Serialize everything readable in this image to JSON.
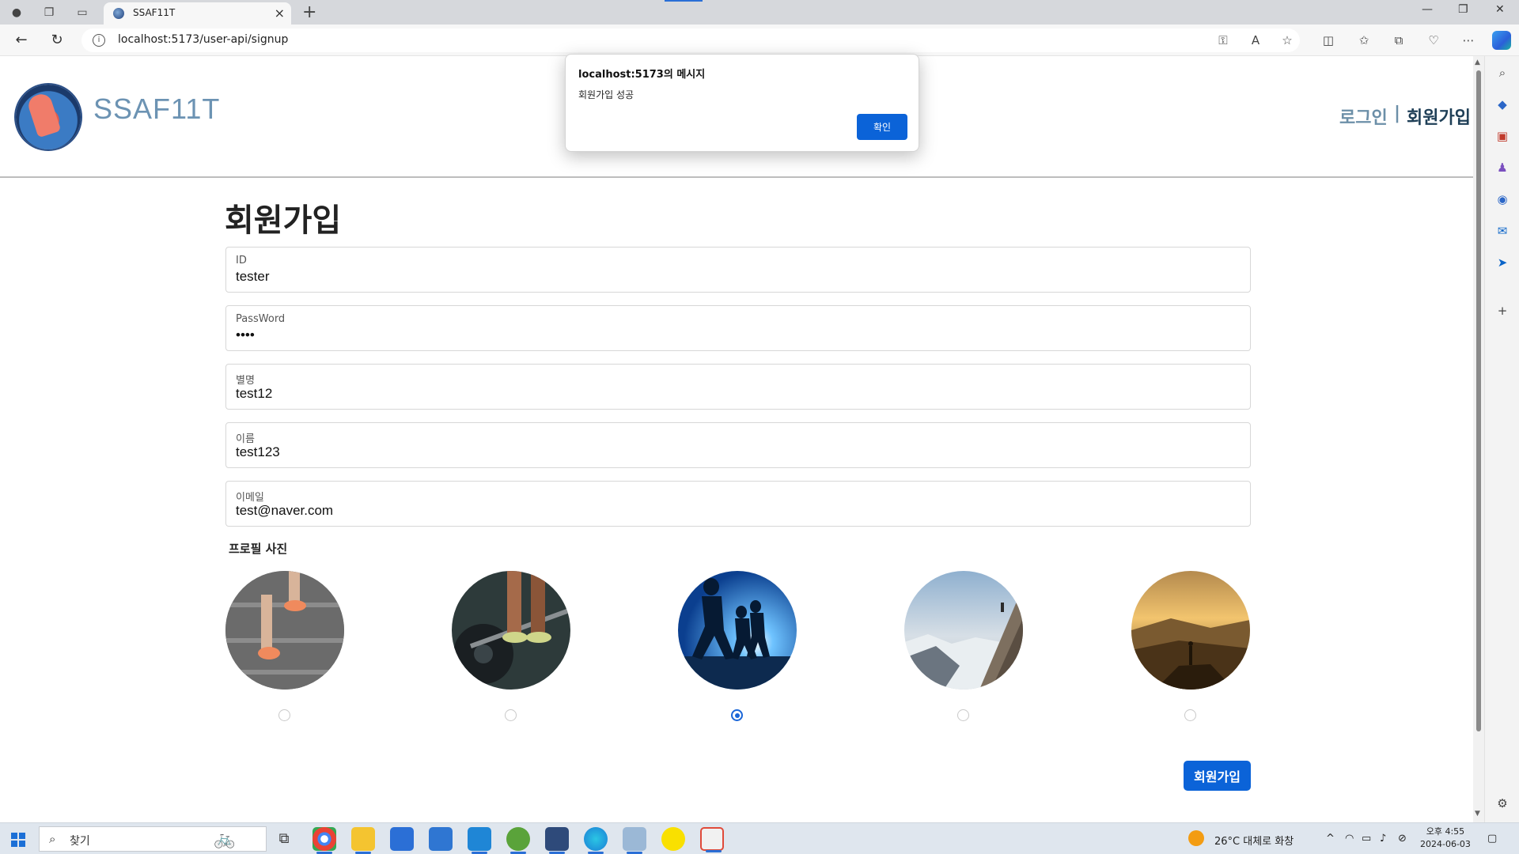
{
  "browser": {
    "tab_title": "SSAF11T",
    "url": "localhost:5173/user-api/signup"
  },
  "site": {
    "brand": "SSAF11T",
    "nav_login": "로그인",
    "nav_separator": "|",
    "nav_signup": "회원가입"
  },
  "form": {
    "title": "회원가입",
    "fields": [
      {
        "label": "ID",
        "value": "tester"
      },
      {
        "label": "PassWord",
        "value": "••••"
      },
      {
        "label": "별명",
        "value": "test12"
      },
      {
        "label": "이름",
        "value": "test123"
      },
      {
        "label": "이메일",
        "value": "test@naver.com"
      }
    ],
    "profile_label": "프로필 사진",
    "profile_images": [
      {
        "icon": "stairs-running-photo",
        "selected": false
      },
      {
        "icon": "barbell-lifting-photo",
        "selected": false
      },
      {
        "icon": "runners-sunrise-photo",
        "selected": true
      },
      {
        "icon": "mountain-cliff-photo",
        "selected": false
      },
      {
        "icon": "mountain-sunset-yoga-photo",
        "selected": false
      }
    ],
    "submit_label": "회원가입"
  },
  "dialog": {
    "title": "localhost:5173의 메시지",
    "message": "회원가입 성공",
    "ok_label": "확인"
  },
  "taskbar": {
    "search_placeholder": "찾기",
    "weather": "26°C 대체로 화창",
    "time": "오후 4:55",
    "date": "2024-06-03"
  },
  "colors": {
    "accent": "#0b63d8",
    "brand": "#6c93b3",
    "nav_active": "#1f3f57"
  }
}
